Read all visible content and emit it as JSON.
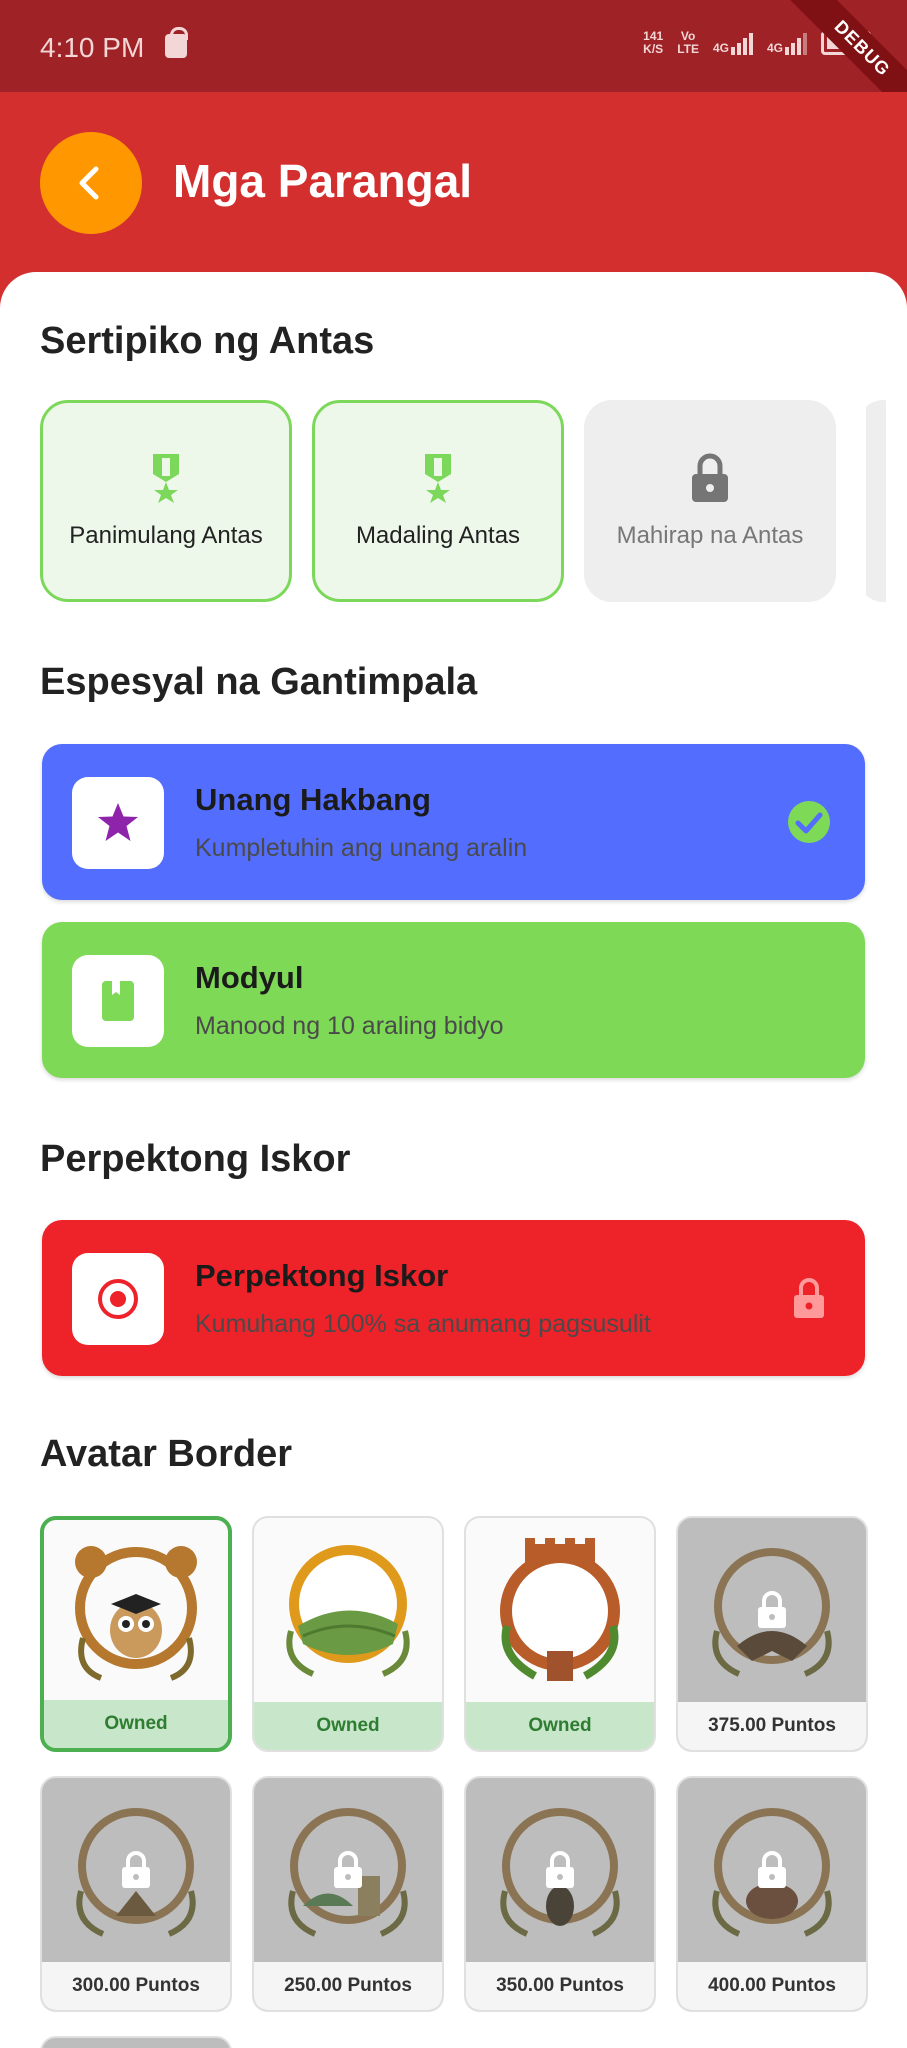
{
  "status_bar": {
    "time": "4:10 PM",
    "net_speed_top": "141",
    "net_speed_bottom": "K/S",
    "volte_top": "Vo",
    "volte_bottom": "LTE",
    "net1": "4G",
    "net2": "4G",
    "debug": "DEBUG"
  },
  "header": {
    "title": "Mga Parangal",
    "back_icon": "chevron-left-icon"
  },
  "colors": {
    "status_bar": "#9e2226",
    "app_bar": "#d32f2f",
    "back_button": "#ff9800",
    "earned_border": "#7cd85a",
    "special_blue": "#536dfe",
    "special_green": "#7ed957",
    "perfect_red": "#ee2229",
    "owned_green": "#4caf50"
  },
  "sections": {
    "certificates": "Sertipiko ng Antas",
    "special": "Espesyal na Gantimpala",
    "perfect": "Perpektong Iskor",
    "avatar": "Avatar Border"
  },
  "certificates": [
    {
      "label": "Panimulang Antas",
      "state": "earned",
      "icon": "medal-icon"
    },
    {
      "label": "Madaling Antas",
      "state": "earned",
      "icon": "medal-icon"
    },
    {
      "label": "Mahirap na Antas",
      "state": "locked",
      "icon": "lock-icon"
    }
  ],
  "special_awards": [
    {
      "title": "Unang Hakbang",
      "desc": "Kumpletuhin ang unang aralin",
      "icon": "star-icon",
      "status": "check-circle-icon"
    },
    {
      "title": "Modyul",
      "desc": "Manood ng 10 araling bidyo",
      "icon": "book-icon",
      "status": ""
    }
  ],
  "perfect_awards": [
    {
      "title": "Perpektong Iskor",
      "desc": "Kumuhang 100% sa anumang pagsusulit",
      "icon": "target-icon",
      "status": "lock-icon"
    }
  ],
  "avatar_borders": [
    {
      "footer": "Owned",
      "state": "owned-selected",
      "art": "tarsier-graduate-border"
    },
    {
      "footer": "Owned",
      "state": "owned",
      "art": "rice-terraces-border"
    },
    {
      "footer": "Owned",
      "state": "owned",
      "art": "fort-wall-border"
    },
    {
      "footer": "375.00 Puntos",
      "state": "locked",
      "art": "bat-border"
    },
    {
      "footer": "300.00 Puntos",
      "state": "locked",
      "art": "hut-border"
    },
    {
      "footer": "250.00 Puntos",
      "state": "locked",
      "art": "church-border"
    },
    {
      "footer": "350.00 Puntos",
      "state": "locked",
      "art": "eagle-border"
    },
    {
      "footer": "400.00 Puntos",
      "state": "locked",
      "art": "boar-border"
    }
  ]
}
